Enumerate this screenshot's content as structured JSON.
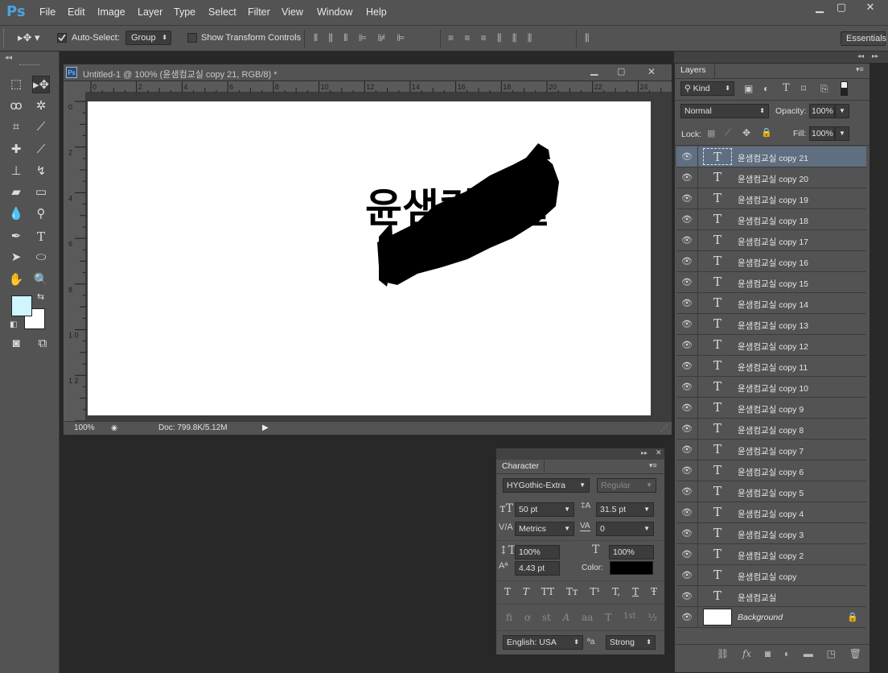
{
  "app": {
    "logo": "Ps"
  },
  "menu": [
    "File",
    "Edit",
    "Image",
    "Layer",
    "Type",
    "Select",
    "Filter",
    "View",
    "Window",
    "Help"
  ],
  "window_controls": {
    "minimize": "▁",
    "restore": "▢",
    "close": "✕"
  },
  "options": {
    "auto_select_label": "Auto-Select:",
    "auto_select_checked": true,
    "auto_select_target": "Group",
    "show_transform_label": "Show Transform Controls",
    "workspace": "Essentials"
  },
  "document": {
    "tab_title": "Untitled-1 @ 100% (윤샘컴교실 copy 21, RGB/8) *",
    "zoom": "100%",
    "doc_info": "Doc: 799.8K/5.12M",
    "ruler_h": [
      "0",
      "2",
      "4",
      "6",
      "8",
      "10",
      "12",
      "14",
      "16",
      "18",
      "20",
      "22",
      "24"
    ],
    "ruler_v": [
      "0",
      "2",
      "4",
      "6",
      "8",
      "1\n0",
      "1\n2"
    ],
    "canvas_text": "윤샘컴교실"
  },
  "layers_panel": {
    "title": "Layers",
    "filter_kind": "Kind",
    "blend_mode": "Normal",
    "opacity_label": "Opacity:",
    "opacity": "100%",
    "lock_label": "Lock:",
    "fill_label": "Fill:",
    "fill": "100%",
    "layers": [
      {
        "name": "윤샘컴교실 copy 21",
        "type": "text",
        "selected": true
      },
      {
        "name": "윤샘컴교실 copy 20",
        "type": "text"
      },
      {
        "name": "윤샘컴교실 copy 19",
        "type": "text"
      },
      {
        "name": "윤샘컴교실 copy 18",
        "type": "text"
      },
      {
        "name": "윤샘컴교실 copy 17",
        "type": "text"
      },
      {
        "name": "윤샘컴교실 copy 16",
        "type": "text"
      },
      {
        "name": "윤샘컴교실 copy 15",
        "type": "text"
      },
      {
        "name": "윤샘컴교실 copy 14",
        "type": "text"
      },
      {
        "name": "윤샘컴교실 copy 13",
        "type": "text"
      },
      {
        "name": "윤샘컴교실 copy 12",
        "type": "text"
      },
      {
        "name": "윤샘컴교실 copy 11",
        "type": "text"
      },
      {
        "name": "윤샘컴교실 copy 10",
        "type": "text"
      },
      {
        "name": "윤샘컴교실 copy 9",
        "type": "text"
      },
      {
        "name": "윤샘컴교실 copy 8",
        "type": "text"
      },
      {
        "name": "윤샘컴교실 copy 7",
        "type": "text"
      },
      {
        "name": "윤샘컴교실 copy 6",
        "type": "text"
      },
      {
        "name": "윤샘컴교실 copy 5",
        "type": "text"
      },
      {
        "name": "윤샘컴교실 copy 4",
        "type": "text"
      },
      {
        "name": "윤샘컴교실 copy 3",
        "type": "text"
      },
      {
        "name": "윤샘컴교실 copy 2",
        "type": "text"
      },
      {
        "name": "윤샘컴교실 copy",
        "type": "text"
      },
      {
        "name": "윤샘컴교실",
        "type": "text"
      },
      {
        "name": "Background",
        "type": "background"
      }
    ]
  },
  "character_panel": {
    "title": "Character",
    "font_family": "HYGothic-Extra",
    "font_style": "Regular",
    "font_size": "50 pt",
    "leading": "31.5 pt",
    "kerning": "Metrics",
    "tracking": "0",
    "vertical_scale": "100%",
    "horizontal_scale": "100%",
    "baseline_shift": "4.43 pt",
    "color_label": "Color:",
    "color": "#000000",
    "style_buttons": [
      "T",
      "T",
      "TT",
      "Tт",
      "T¹",
      "T,",
      "T",
      "Ŧ"
    ],
    "opentype_buttons": [
      "fi",
      "ơ",
      "st",
      "A",
      "aa",
      "T",
      "1st",
      "½"
    ],
    "language": "English: USA",
    "aa_label": "ªa",
    "antialias": "Strong"
  },
  "colors": {
    "foreground": "#cff5ff",
    "background": "#ffffff",
    "ui_base": "#535353",
    "layer_selected": "#5f6e80"
  }
}
